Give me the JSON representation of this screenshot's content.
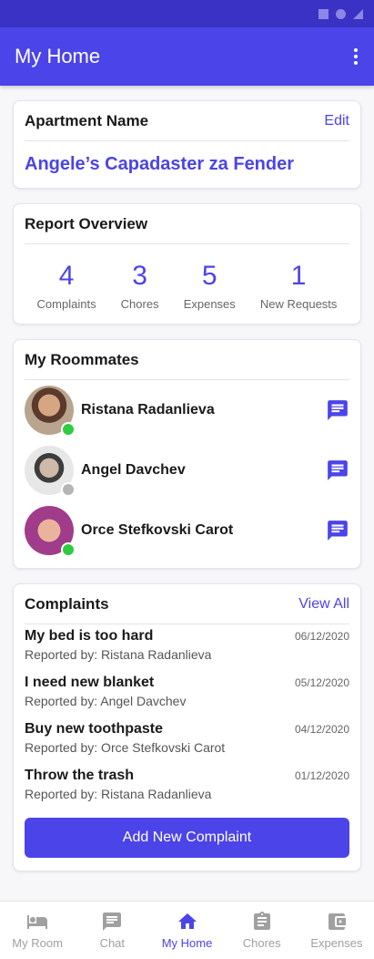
{
  "colors": {
    "primary": "#4b44e8",
    "status_bar": "#3a32c4",
    "online": "#2ecc40",
    "offline": "#b5b5b5",
    "inactive": "#a0a0a0"
  },
  "app_bar": {
    "title": "My Home",
    "menu_icon": "more-vert-icon"
  },
  "apartment": {
    "heading": "Apartment Name",
    "edit_label": "Edit",
    "name": "Angele’s Capadaster za Fender"
  },
  "overview": {
    "heading": "Report Overview",
    "stats": [
      {
        "value": "4",
        "label": "Complaints"
      },
      {
        "value": "3",
        "label": "Chores"
      },
      {
        "value": "5",
        "label": "Expenses"
      },
      {
        "value": "1",
        "label": "New Requests"
      }
    ]
  },
  "roommates": {
    "heading": "My Roommates",
    "items": [
      {
        "name": "Ristana Radanlieva",
        "status": "online",
        "icon": "message-icon"
      },
      {
        "name": "Angel Davchev",
        "status": "offline",
        "icon": "message-icon"
      },
      {
        "name": "Orce Stefkovski Carot",
        "status": "online",
        "icon": "message-icon"
      }
    ]
  },
  "complaints": {
    "heading": "Complaints",
    "view_all_label": "View All",
    "items": [
      {
        "title": "My bed is too hard",
        "reporter": "Reported by: Ristana Radanlieva",
        "date": "06/12/2020"
      },
      {
        "title": "I need new blanket",
        "reporter": "Reported by: Angel Davchev",
        "date": "05/12/2020"
      },
      {
        "title": "Buy new toothpaste",
        "reporter": "Reported by: Orce Stefkovski Carot",
        "date": "04/12/2020"
      },
      {
        "title": "Throw the trash",
        "reporter": "Reported by: Ristana Radanlieva",
        "date": "01/12/2020"
      }
    ],
    "add_button_label": "Add New Complaint"
  },
  "bottom_nav": {
    "items": [
      {
        "label": "My Room",
        "icon": "bed-icon",
        "active": false
      },
      {
        "label": "Chat",
        "icon": "chat-icon",
        "active": false
      },
      {
        "label": "My Home",
        "icon": "home-icon",
        "active": true
      },
      {
        "label": "Chores",
        "icon": "clipboard-icon",
        "active": false
      },
      {
        "label": "Expenses",
        "icon": "wallet-icon",
        "active": false
      }
    ]
  }
}
